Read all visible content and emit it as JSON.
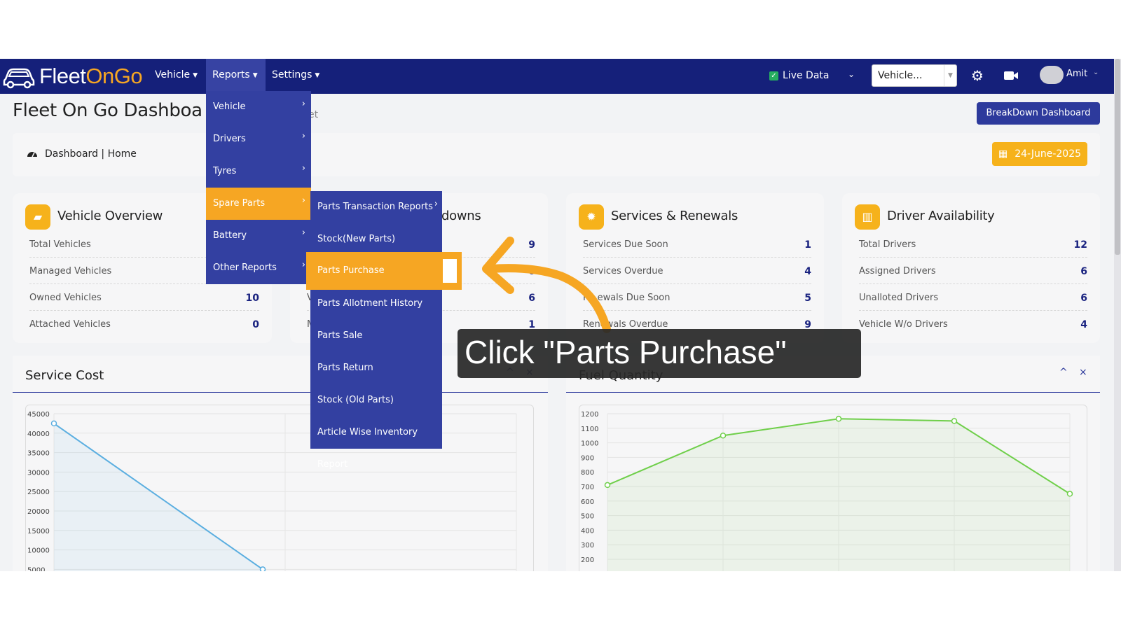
{
  "navbar": {
    "logo": {
      "part1": "Fleet",
      "part2": "OnGo"
    },
    "menu": [
      {
        "label": "Vehicle"
      },
      {
        "label": "Reports"
      },
      {
        "label": "Settings"
      }
    ],
    "live_data_label": "Live Data",
    "vehicle_select_value": "Vehicle...",
    "user_name": "Amit"
  },
  "page": {
    "title": "Fleet On Go Dashboa",
    "title_tail": "et",
    "breakdown_button": "BreakDown Dashboard",
    "breadcrumb": "Dashboard | Home",
    "date": "24-June-2025"
  },
  "cards": [
    {
      "title": "Vehicle Overview",
      "rows": [
        {
          "label": "Total Vehicles",
          "value": ""
        },
        {
          "label": "Managed Vehicles",
          "value": ""
        },
        {
          "label": "Owned Vehicles",
          "value": "10"
        },
        {
          "label": "Attached Vehicles",
          "value": "0"
        }
      ]
    },
    {
      "title": "downs",
      "rows": [
        {
          "label": "",
          "value": "9"
        },
        {
          "label": "",
          "value": "0"
        },
        {
          "label": "V",
          "value": "6"
        },
        {
          "label": "M",
          "value": "1"
        }
      ]
    },
    {
      "title": "Services & Renewals",
      "rows": [
        {
          "label": "Services Due Soon",
          "value": "1"
        },
        {
          "label": "Services Overdue",
          "value": "4"
        },
        {
          "label": "Re ewals Due Soon",
          "value": "5"
        },
        {
          "label": "Renewals Overdue",
          "value": "9"
        }
      ]
    },
    {
      "title": "Driver Availability",
      "rows": [
        {
          "label": "Total Drivers",
          "value": "12"
        },
        {
          "label": "Assigned Drivers",
          "value": "6"
        },
        {
          "label": "Unalloted Drivers",
          "value": "6"
        },
        {
          "label": "Vehicle W/o Drivers",
          "value": "4"
        }
      ]
    }
  ],
  "panels": {
    "service_cost": {
      "title": "Service Cost",
      "collapse": "^",
      "close": "×"
    },
    "fuel_quantity": {
      "title": "Fuel Quantity",
      "collapse": "^",
      "close": "×"
    }
  },
  "reports_menu": [
    {
      "label": "Vehicle"
    },
    {
      "label": "Drivers"
    },
    {
      "label": "Tyres"
    },
    {
      "label": "Spare Parts"
    },
    {
      "label": "Battery"
    },
    {
      "label": "Other Reports"
    }
  ],
  "spare_parts_submenu": [
    {
      "label": "Parts Transaction Reports"
    },
    {
      "label": "Stock(New Parts)"
    },
    {
      "label": "Parts Purchase"
    },
    {
      "label": "Parts Allotment History"
    },
    {
      "label": "Parts Sale"
    },
    {
      "label": "Parts Return"
    },
    {
      "label": "Stock (Old Parts)"
    },
    {
      "label": "Article Wise Inventory Report"
    }
  ],
  "callout": {
    "text": "Click \"Parts Purchase\""
  },
  "chart_data": [
    {
      "type": "line",
      "title": "Service Cost",
      "y_ticks": [
        "45000",
        "40000",
        "35000",
        "30000",
        "25000",
        "20000",
        "15000",
        "10000",
        "5000"
      ],
      "ylim": [
        5000,
        45000
      ],
      "series": [
        {
          "values": [
            42500,
            5000
          ]
        }
      ],
      "color": "#5aaee0",
      "grid": true
    },
    {
      "type": "line",
      "title": "Fuel Quantity",
      "y_ticks": [
        "1200",
        "1100",
        "1000",
        "900",
        "800",
        "700",
        "600",
        "500",
        "400",
        "300",
        "200"
      ],
      "ylim": [
        200,
        1200
      ],
      "series": [
        {
          "values": [
            710,
            1050,
            1165,
            1150,
            650
          ]
        }
      ],
      "color": "#6fcf4a",
      "grid": true
    }
  ],
  "colors": {
    "navbar": "#15207a",
    "accent": "#f6a623",
    "menu": "#3340a1",
    "value_text": "#1a2380"
  }
}
